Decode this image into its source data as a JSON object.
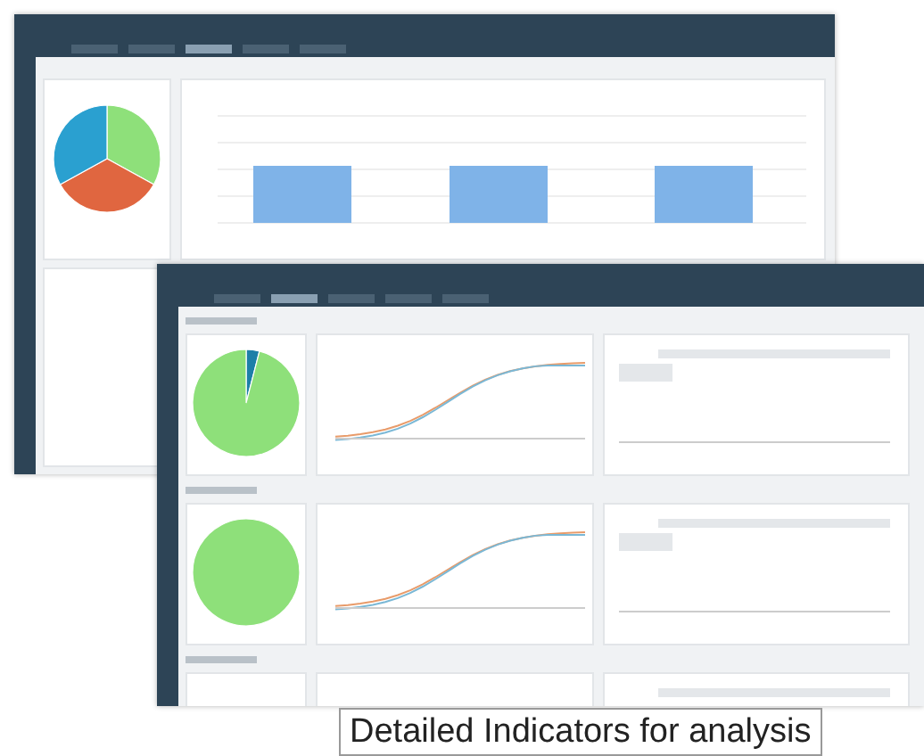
{
  "back_window": {
    "tabs": [
      {
        "selected": false
      },
      {
        "selected": false
      },
      {
        "selected": true
      },
      {
        "selected": false
      },
      {
        "selected": false
      }
    ]
  },
  "front_window": {
    "tabs": [
      {
        "selected": false
      },
      {
        "selected": true
      },
      {
        "selected": false
      },
      {
        "selected": false
      },
      {
        "selected": false
      }
    ],
    "sections": [
      {
        "kind": "full"
      },
      {
        "kind": "full"
      },
      {
        "kind": "cut"
      }
    ]
  },
  "caption": "Detailed Indicators for analysis"
}
